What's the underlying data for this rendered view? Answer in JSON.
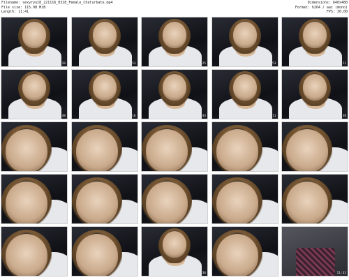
{
  "header": {
    "left_lines": [
      "Filename: sexyryu18_221116_0328_Female_Chaturbate.mp4",
      "File size: 115.98 MiB",
      "Length: 11:41"
    ],
    "right_lines": [
      "Dimensions: 640x480",
      "Format: h264 / aac (mono)",
      "FPS: 30.00"
    ]
  },
  "thumbnails": [
    {
      "time": "00:28"
    },
    {
      "time": "00:53"
    },
    {
      "time": "01:25"
    },
    {
      "time": "01:53"
    },
    {
      "time": "02:21"
    },
    {
      "time": "02:48"
    },
    {
      "time": "03:16"
    },
    {
      "time": "03:43"
    },
    {
      "time": "04:11"
    },
    {
      "time": "04:38"
    },
    {
      "time": "05:06"
    },
    {
      "time": "05:33"
    },
    {
      "time": "06:01"
    },
    {
      "time": "06:28"
    },
    {
      "time": "06:56"
    },
    {
      "time": "07:23"
    },
    {
      "time": "07:51"
    },
    {
      "time": "08:18"
    },
    {
      "time": "08:46"
    },
    {
      "time": "09:13"
    },
    {
      "time": "09:41"
    },
    {
      "time": "10:08"
    },
    {
      "time": "10:36"
    },
    {
      "time": "11:03"
    },
    {
      "time": "11:31"
    }
  ]
}
